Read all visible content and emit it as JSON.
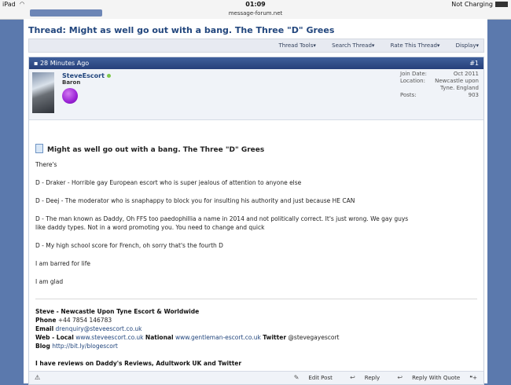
{
  "status_bar": {
    "device": "iPad",
    "time": "01:09",
    "charging": "Not Charging",
    "url": "message-forum.net"
  },
  "thread": {
    "label": "Thread:",
    "title": "Might as well go out with a bang. The Three \"D\" Grees"
  },
  "toolbar": {
    "tools": "Thread Tools",
    "search": "Search Thread",
    "rate": "Rate This Thread",
    "display": "Display"
  },
  "post": {
    "time": "28 Minutes Ago",
    "number": "#1",
    "user": {
      "name": "SteveEscort",
      "rank": "Baron"
    },
    "meta": {
      "join_label": "Join Date:",
      "join_value": "Oct 2011",
      "location_label": "Location:",
      "location_line1": "Newcastle upon",
      "location_line2": "Tyne. England",
      "posts_label": "Posts:",
      "posts_value": "903"
    },
    "title": "Might as well go out with a bang. The Three \"D\" Grees",
    "lines": [
      "There's",
      "D - Draker - Horrible gay European escort who is super jealous of attention to anyone else",
      "D - Deej - The moderator who is snaphappy to block you for insulting his authority and just because HE CAN",
      "D - The man known as Daddy, Oh FFS too paedophillia a name in 2014 and not politically correct. It's just wrong. We gay guys",
      "like daddy types. Not in a word promoting you. You need to change and quick",
      "D - My high school score for French, oh sorry that's the fourth D",
      "I am barred for life",
      "I am glad"
    ],
    "signature": {
      "title": "Steve - Newcastle Upon Tyne Escort & Worldwide",
      "phone_label": "Phone",
      "phone": "+44 7854 146783",
      "email_label": "Email",
      "email": "drenquiry@steveescort.co.uk",
      "web_label": "Web - Local",
      "web_local": "www.steveescort.co.uk",
      "national_label": "National",
      "web_national": "www.gentleman-escort.co.uk",
      "twitter_label": "Twitter",
      "twitter": "@stevegayescort",
      "blog_label": "Blog",
      "blog": "http://bit.ly/blogescort",
      "reviews": "I have reviews on Daddy's Reviews, Adultwork UK and Twitter"
    },
    "actions": {
      "edit": "Edit Post",
      "reply": "Reply",
      "quote": "Reply With Quote"
    }
  }
}
